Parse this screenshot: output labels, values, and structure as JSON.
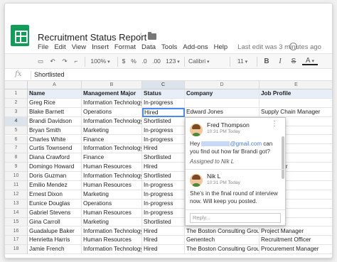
{
  "doc": {
    "title": "Recruitment Status Report",
    "last_edit": "Last edit was 3 minutes ago"
  },
  "menu": [
    "File",
    "Edit",
    "View",
    "Insert",
    "Format",
    "Data",
    "Tools",
    "Add-ons",
    "Help"
  ],
  "toolbar": {
    "zoom": "100%",
    "currency": "$",
    "percent": "%",
    "decimal_dec": ".0",
    "decimal_inc": ".00",
    "number_format": "123",
    "font": "Calibri",
    "font_size": "11",
    "bold": "B",
    "italic": "I",
    "strike": "S",
    "text_color": "A"
  },
  "formula_bar": {
    "fx": "fx",
    "value": "Shortlisted"
  },
  "columns": [
    "A",
    "B",
    "C",
    "D",
    "E"
  ],
  "active_column": "C",
  "active_row": "4",
  "table": {
    "headers": [
      "Name",
      "Management Major",
      "Status",
      "Company",
      "Job Profile"
    ],
    "rows": [
      [
        "Greg Rice",
        "Information Technology",
        "In-progress",
        "",
        ""
      ],
      [
        "Blake Barnett",
        "Operations",
        "Hired",
        "Edward Jones",
        "Supply Chain Manager"
      ],
      [
        "Brandi Davidson",
        "Information Technology",
        "Shortlisted",
        "",
        ""
      ],
      [
        "Bryan Smith",
        "Marketing",
        "In-progress",
        "",
        ""
      ],
      [
        "Charles White",
        "Finance",
        "In-progress",
        "",
        ""
      ],
      [
        "Curtis Townsend",
        "Information Technology",
        "Hired",
        "",
        "anager"
      ],
      [
        "Diana Crawford",
        "Finance",
        "Shortlisted",
        "",
        "anager"
      ],
      [
        "Domingo Howard",
        "Human Resources",
        "Hired",
        "",
        "ent Officer"
      ],
      [
        "Doris Guzman",
        "Information Technology",
        "Shortlisted",
        "",
        "anager"
      ],
      [
        "Emilio Mendez",
        "Human Resources",
        "In-progress",
        "",
        ""
      ],
      [
        "Ernest Dixon",
        "Marketing",
        "In-progress",
        "",
        ""
      ],
      [
        "Eunice Douglas",
        "Operations",
        "In-progress",
        "",
        ""
      ],
      [
        "Gabriel Stevens",
        "Human Resources",
        "In-progress",
        "",
        ""
      ],
      [
        "Gina Carroll",
        "Marketing",
        "Shortlisted",
        "",
        ""
      ],
      [
        "Guadalupe Baker",
        "Information Technology",
        "Hired",
        "The Boston Consulting Group",
        "Project Manager"
      ],
      [
        "Henrietta Harris",
        "Human Resources",
        "Hired",
        "Genentech",
        "Recruitment Officer"
      ],
      [
        "Jamie French",
        "Information Technology",
        "Hired",
        "The Boston Consulting Group",
        "Procurement Manager"
      ]
    ]
  },
  "comment": {
    "author1": "Fred Thompson",
    "time1": "10:31 PM Today",
    "text1_a": "Hey",
    "text1_email": "@gmail.com",
    "text1_b": "can you find out how far Brandi got?",
    "assigned": "Assigned to Nik L",
    "author2": "Nik L",
    "time2": "10:31 PM Today",
    "text2": "She's in the final round of interview now. Will keep you posted.",
    "reply_placeholder": "Reply..."
  }
}
